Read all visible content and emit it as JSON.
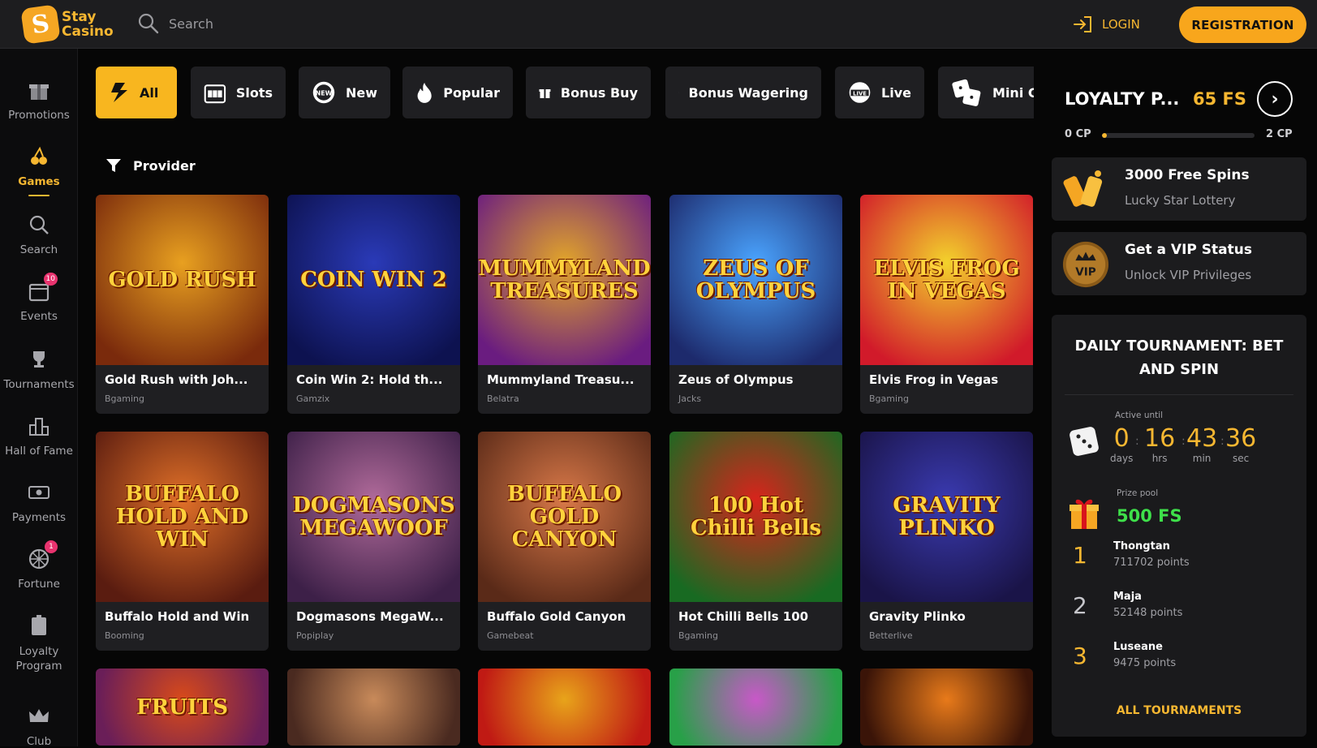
{
  "header": {
    "logo_line1": "Stay",
    "logo_line2": "Casino",
    "search_placeholder": "Search",
    "login_label": "LOGIN",
    "registration_label": "REGISTRATION"
  },
  "sidebar": {
    "items": [
      {
        "label": "Promotions",
        "icon": "gift-icon"
      },
      {
        "label": "Games",
        "icon": "cherries-icon",
        "active": true
      },
      {
        "label": "Search",
        "icon": "search-icon"
      },
      {
        "label": "Events",
        "icon": "calendar-icon",
        "badge": "10"
      },
      {
        "label": "Tournaments",
        "icon": "trophy-icon"
      },
      {
        "label": "Hall of Fame",
        "icon": "podium-icon"
      },
      {
        "label": "Payments",
        "icon": "cash-icon"
      },
      {
        "label": "Fortune",
        "icon": "wheel-icon",
        "badge": "1"
      },
      {
        "label": "Loyalty\nProgram",
        "icon": "vip-card-icon"
      },
      {
        "label": "Club",
        "icon": "crown-icon"
      }
    ]
  },
  "categories": [
    {
      "label": "All",
      "icon": "lightning-s-icon",
      "active": true
    },
    {
      "label": "Slots",
      "icon": "slot-machine-icon"
    },
    {
      "label": "New",
      "icon": "new-badge-icon"
    },
    {
      "label": "Popular",
      "icon": "fire-icon"
    },
    {
      "label": "Bonus Buy",
      "icon": "gift-icon"
    },
    {
      "label": "Bonus Wagering",
      "icon": "dollar-cycle-icon"
    },
    {
      "label": "Live",
      "icon": "live-icon"
    },
    {
      "label": "Mini G",
      "icon": "dice-icon"
    }
  ],
  "filter": {
    "provider_label": "Provider"
  },
  "games": [
    {
      "name": "Gold Rush with Joh...",
      "provider": "Bgaming",
      "art": "GOLD RUSH",
      "c1": "#e8a020",
      "c2": "#7a2a0c"
    },
    {
      "name": "Coin Win 2: Hold th...",
      "provider": "Gamzix",
      "art": "COIN WIN 2",
      "c1": "#2a3ab8",
      "c2": "#0d1250"
    },
    {
      "name": "Mummyland Treasu...",
      "provider": "Belatra",
      "art": "MUMMYLAND TREASURES",
      "c1": "#e2a52a",
      "c2": "#6a1c80"
    },
    {
      "name": "Zeus of Olympus",
      "provider": "Jacks",
      "art": "ZEUS OF OLYMPUS",
      "c1": "#4aa4ff",
      "c2": "#1d2a6c"
    },
    {
      "name": "Elvis Frog in Vegas",
      "provider": "Bgaming",
      "art": "ELVIS FROG IN VEGAS",
      "c1": "#f3d22c",
      "c2": "#d11a2a"
    },
    {
      "name": "Buffalo Hold and Win",
      "provider": "Booming",
      "art": "BUFFALO HOLD AND WIN",
      "c1": "#e07028",
      "c2": "#5a1c10"
    },
    {
      "name": "Dogmasons MegaW...",
      "provider": "Popiplay",
      "art": "DOGMASONS MEGAWOOF",
      "c1": "#b06a9a",
      "c2": "#3d2048"
    },
    {
      "name": "Buffalo Gold Canyon",
      "provider": "Gamebeat",
      "art": "BUFFALO GOLD CANYON",
      "c1": "#d87848",
      "c2": "#5a2a18"
    },
    {
      "name": "Hot Chilli Bells 100",
      "provider": "Bgaming",
      "art": "100 Hot Chilli Bells",
      "c1": "#d8241c",
      "c2": "#186a22"
    },
    {
      "name": "Gravity Plinko",
      "provider": "Betterlive",
      "art": "GRAVITY PLINKO",
      "c1": "#3a3ab0",
      "c2": "#1a1448"
    },
    {
      "name": "",
      "provider": "",
      "art": "FRUITS",
      "c1": "#d84a1a",
      "c2": "#6a1e58"
    },
    {
      "name": "",
      "provider": "",
      "art": "",
      "c1": "#c88a5a",
      "c2": "#4a2a20"
    },
    {
      "name": "",
      "provider": "",
      "art": "",
      "c1": "#e8a41a",
      "c2": "#c01a14"
    },
    {
      "name": "",
      "provider": "",
      "art": "",
      "c1": "#c858c8",
      "c2": "#28a048"
    },
    {
      "name": "",
      "provider": "",
      "art": "",
      "c1": "#e87a1a",
      "c2": "#3a1408"
    }
  ],
  "loyalty": {
    "title": "LOYALTY P...",
    "fs": "65 FS",
    "min_label": "0 CP",
    "max_label": "2 CP",
    "progress_fraction": 0.03
  },
  "promos": [
    {
      "title": "3000 Free Spins",
      "subtitle": "Lucky Star Lottery",
      "icon": "lottery-tickets-icon"
    },
    {
      "title": "Get a VIP Status",
      "subtitle": "Unlock VIP Privileges",
      "icon": "vip-crown-icon"
    }
  ],
  "tournament": {
    "title": "DAILY TOURNAMENT: BET AND SPIN",
    "active_until_label": "Active until",
    "countdown": [
      {
        "value": "0",
        "unit": "days"
      },
      {
        "value": "16",
        "unit": "hrs"
      },
      {
        "value": "43",
        "unit": "min"
      },
      {
        "value": "36",
        "unit": "sec"
      }
    ],
    "prize_pool_label": "Prize pool",
    "prize_pool": "500 FS",
    "leaders": [
      {
        "rank": "1",
        "name": "Thongtan",
        "points": "711702 points"
      },
      {
        "rank": "2",
        "name": "Maja",
        "points": "52148 points"
      },
      {
        "rank": "3",
        "name": "Luseane",
        "points": "9475 points"
      }
    ],
    "all_label": "ALL TOURNAMENTS"
  },
  "colors": {
    "accent": "#f8a61c",
    "accent_text": "#f7b731",
    "panel": "#1f1f22",
    "background": "#060606",
    "prize_green": "#3ee04a"
  }
}
